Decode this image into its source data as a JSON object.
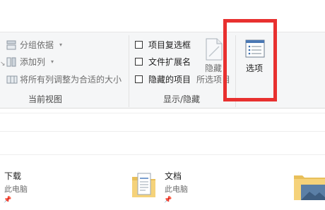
{
  "ribbon": {
    "view_group": {
      "group_by_label": "分组依据",
      "add_column_label": "添加列",
      "size_all_columns_label": "将所有列调整为合适的大小",
      "group_label": "当前视图"
    },
    "show_hide_group": {
      "item_checkboxes_label": "项目复选框",
      "file_extensions_label": "文件扩展名",
      "hidden_items_label": "隐藏的项目",
      "hide_selected_label_line1": "隐藏",
      "hide_selected_label_line2": "所选项目",
      "group_label": "显示/隐藏"
    },
    "options_label": "选项"
  },
  "highlight": {
    "color": "#e8302f"
  },
  "quick_access": {
    "items": [
      {
        "name": "下载",
        "location": "此电脑"
      },
      {
        "name": "文档",
        "location": "此电脑"
      }
    ]
  }
}
